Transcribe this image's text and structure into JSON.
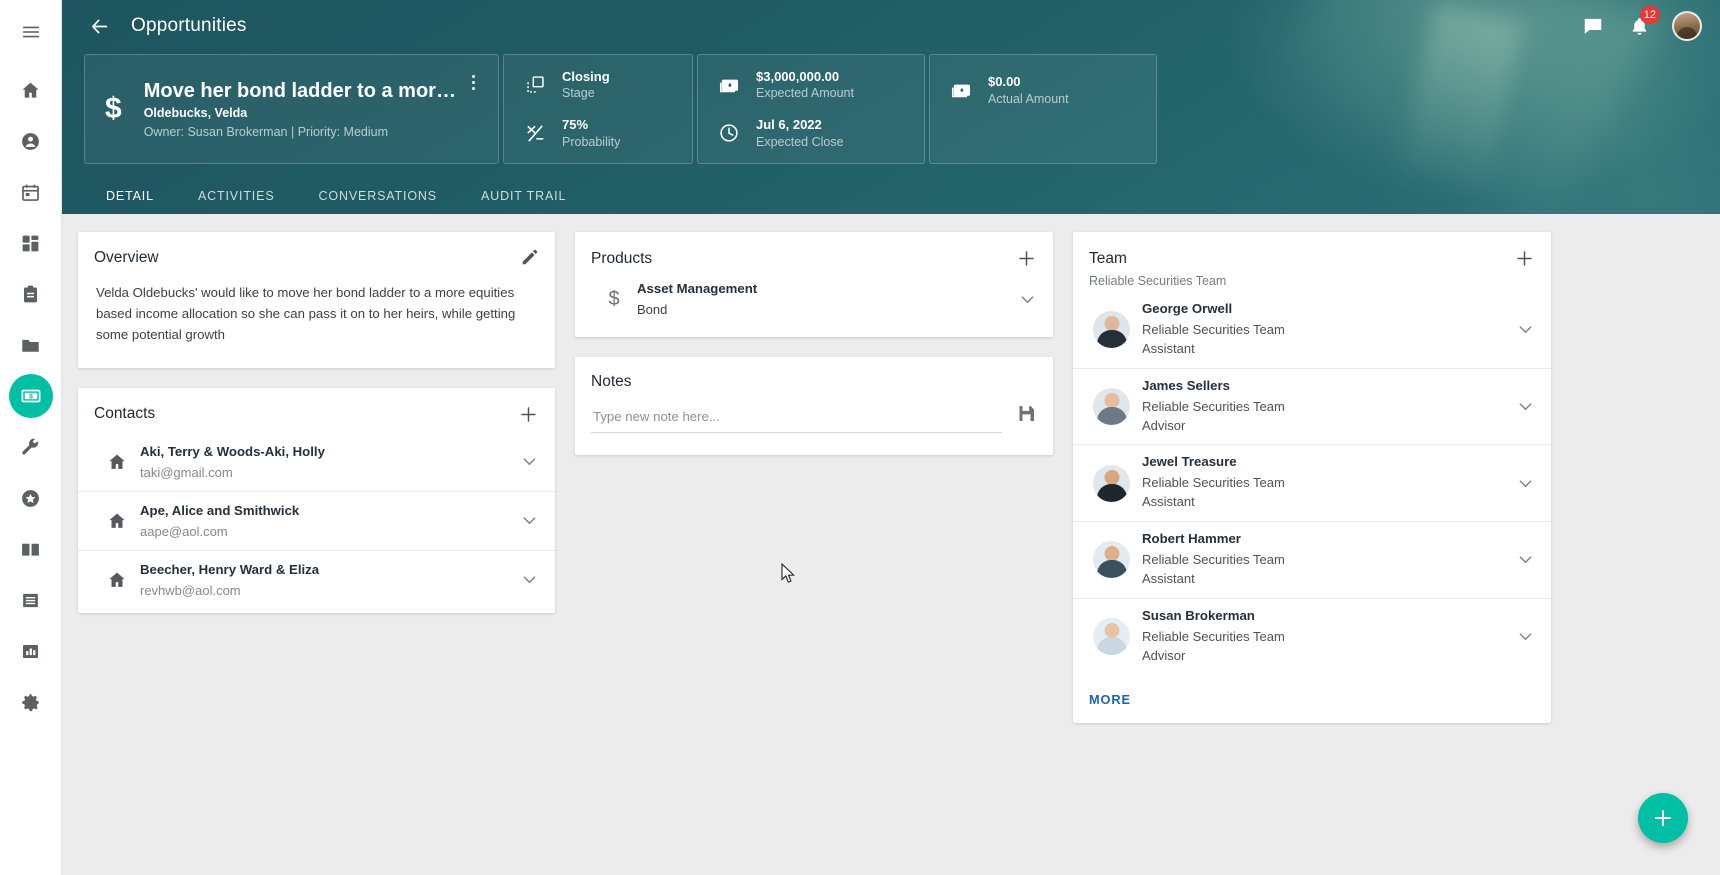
{
  "sidebar": {
    "items": [
      {
        "name": "menu-icon",
        "label": "Menu"
      },
      {
        "name": "home-icon",
        "label": "Home"
      },
      {
        "name": "contacts-icon",
        "label": "Contacts"
      },
      {
        "name": "calendar-icon",
        "label": "Calendar"
      },
      {
        "name": "dashboard-icon",
        "label": "Dashboard"
      },
      {
        "name": "tasks-icon",
        "label": "Tasks"
      },
      {
        "name": "files-icon",
        "label": "Files"
      },
      {
        "name": "opportunities-icon",
        "label": "Opportunities"
      },
      {
        "name": "tools-icon",
        "label": "Tools"
      },
      {
        "name": "favorites-icon",
        "label": "Favorites"
      },
      {
        "name": "library-icon",
        "label": "Library"
      },
      {
        "name": "notes-icon",
        "label": "Notes"
      },
      {
        "name": "reports-icon",
        "label": "Reports"
      },
      {
        "name": "settings-icon",
        "label": "Settings"
      }
    ],
    "active_index": 7
  },
  "header": {
    "back_label": "Back",
    "title": "Opportunities",
    "messages_icon": "chat-icon",
    "notifications_icon": "bell-icon",
    "notifications_count": "12",
    "avatar_label": "User profile"
  },
  "opportunity": {
    "currency_icon": "dollar-icon",
    "title": "Move her bond ladder to a more…",
    "account": "Oldebucks, Velda",
    "meta": "Owner: Susan Brokerman | Priority: Medium",
    "menu_icon": "kebab-menu-icon"
  },
  "metrics": [
    {
      "icon": "stage-icon",
      "value": "Closing",
      "label": "Stage"
    },
    {
      "icon": "probability-icon",
      "value": "75%",
      "label": "Probability"
    },
    {
      "icon": "money-icon",
      "value": "$3,000,000.00",
      "label": "Expected Amount"
    },
    {
      "icon": "clock-icon",
      "value": "Jul 6, 2022",
      "label": "Expected Close"
    },
    {
      "icon": "money-icon",
      "value": "$0.00",
      "label": "Actual Amount"
    }
  ],
  "tabs": [
    {
      "label": "DETAIL",
      "active": true
    },
    {
      "label": "ACTIVITIES",
      "active": false
    },
    {
      "label": "CONVERSATIONS",
      "active": false
    },
    {
      "label": "AUDIT TRAIL",
      "active": false
    }
  ],
  "overview": {
    "title": "Overview",
    "edit_icon": "pencil-icon",
    "text": "Velda Oldebucks' would like to move her bond ladder to a more equities based income allocation so she can pass it on to her heirs, while getting some potential growth"
  },
  "contacts": {
    "title": "Contacts",
    "add_icon": "plus-icon",
    "items": [
      {
        "icon": "household-icon",
        "name": "Aki, Terry & Woods-Aki, Holly",
        "email": "taki@gmail.com"
      },
      {
        "icon": "household-icon",
        "name": "Ape, Alice and Smithwick",
        "email": "aape@aol.com"
      },
      {
        "icon": "household-icon",
        "name": "Beecher, Henry Ward & Eliza",
        "email": "revhwb@aol.com"
      }
    ]
  },
  "products": {
    "title": "Products",
    "add_icon": "plus-icon",
    "items": [
      {
        "icon": "dollar-icon",
        "name": "Asset Management",
        "type": "Bond",
        "chevron": "chevron-down-icon"
      }
    ]
  },
  "notes": {
    "title": "Notes",
    "placeholder": "Type new note here...",
    "value": "",
    "save_icon": "save-icon"
  },
  "team": {
    "title": "Team",
    "add_icon": "plus-icon",
    "subtitle": "Reliable Securities Team",
    "more_label": "MORE",
    "members": [
      {
        "name": "George Orwell",
        "team": "Reliable Securities Team",
        "role": "Assistant",
        "skin": "#e0b79a",
        "hair": "#3b2e26",
        "suit": "#262f38"
      },
      {
        "name": "James Sellers",
        "team": "Reliable Securities Team",
        "role": "Advisor",
        "skin": "#e6bd9e",
        "hair": "#5a4535",
        "suit": "#6d7a85"
      },
      {
        "name": "Jewel Treasure",
        "team": "Reliable Securities Team",
        "role": "Assistant",
        "skin": "#d9a77f",
        "hair": "#2a1d16",
        "suit": "#1f2630"
      },
      {
        "name": "Robert Hammer",
        "team": "Reliable Securities Team",
        "role": "Assistant",
        "skin": "#dfae86",
        "hair": "#c8b7a8",
        "suit": "#39505f"
      },
      {
        "name": "Susan Brokerman",
        "team": "Reliable Securities Team",
        "role": "Advisor",
        "skin": "#e9c2a4",
        "hair": "#9a9a98",
        "suit": "#c8d7e2"
      }
    ]
  },
  "fab": {
    "icon": "plus-icon",
    "label": "Add"
  },
  "colors": {
    "accent": "#00bfa5",
    "banner": "#1e5560",
    "link": "#1565c0",
    "badge": "#e53935"
  }
}
